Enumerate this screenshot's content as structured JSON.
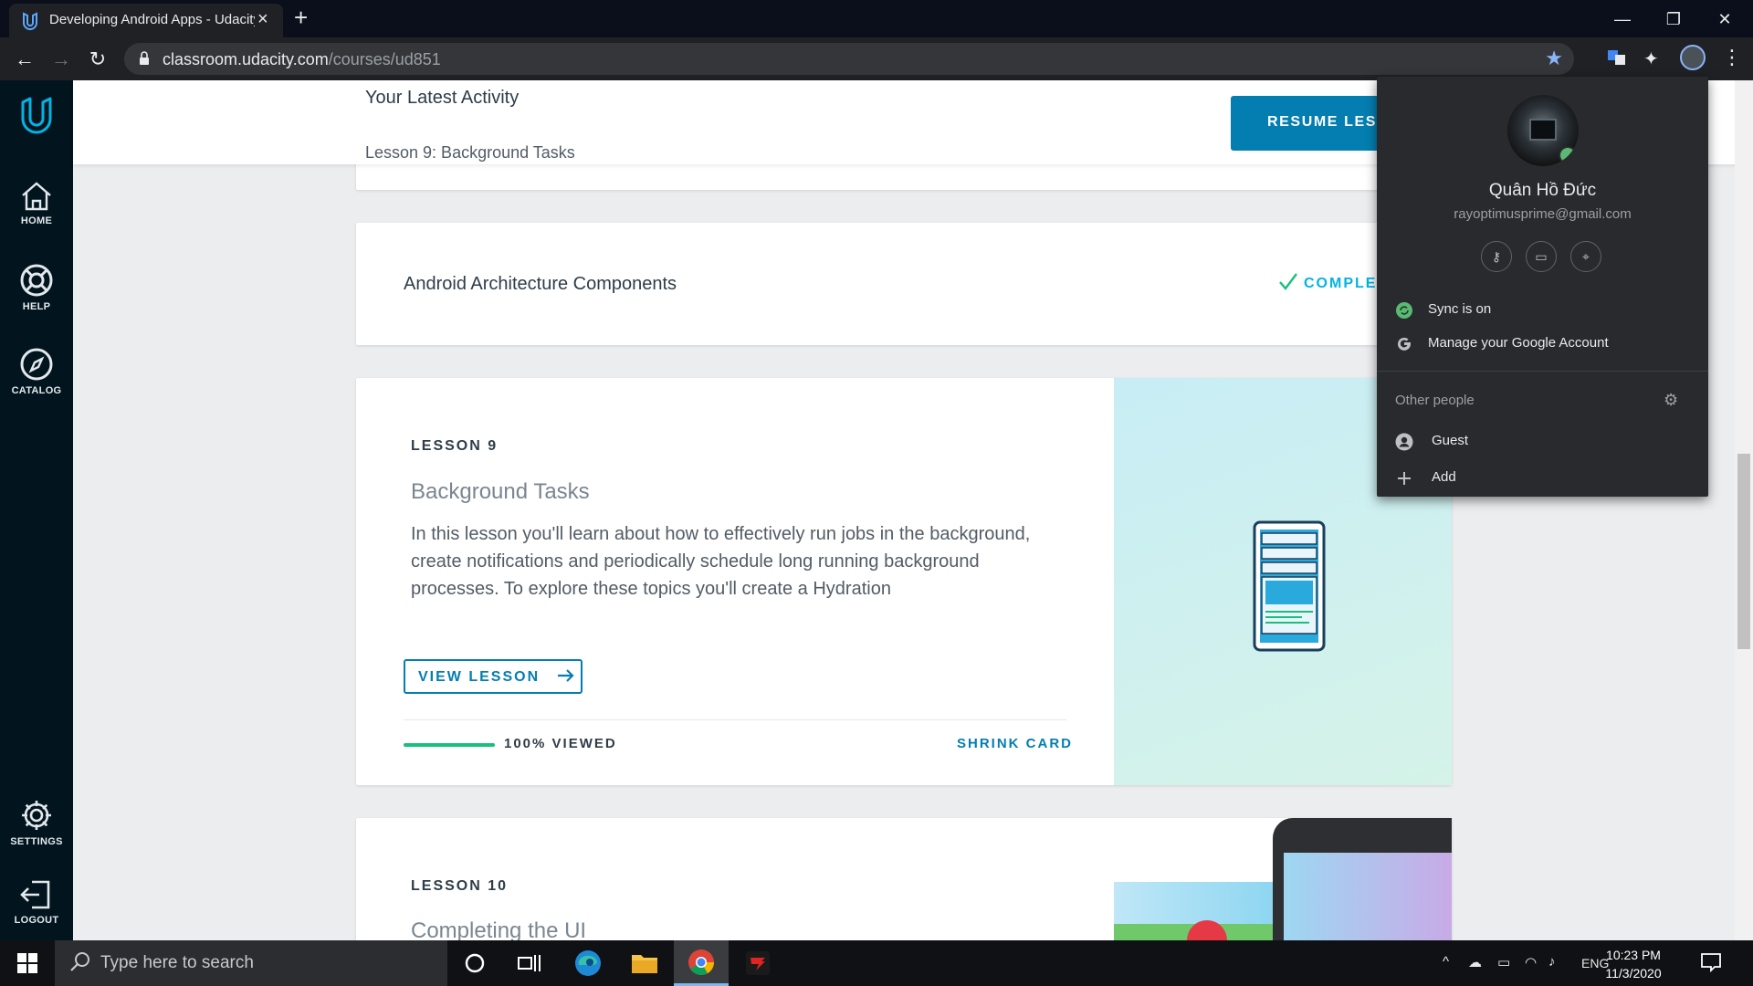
{
  "browser": {
    "tab_title": "Developing Android Apps - Udacity",
    "new_tab_symbol": "+",
    "url_host": "classroom.udacity.com",
    "url_path": "/courses/ud851",
    "colors": {
      "titlebar": "#0b0f1c",
      "toolbar": "#202124",
      "omnibox": "#35363a",
      "star": "#8ab4f8"
    }
  },
  "sidebar": {
    "items": [
      {
        "label": "HOME",
        "icon": "home-icon"
      },
      {
        "label": "HELP",
        "icon": "lifebuoy-icon"
      },
      {
        "label": "CATALOG",
        "icon": "compass-icon"
      },
      {
        "label": "SETTINGS",
        "icon": "gear-icon"
      },
      {
        "label": "LOGOUT",
        "icon": "logout-icon"
      }
    ],
    "logo_icon": "udacity-logo-icon",
    "colors": {
      "background": "#02151f",
      "logo": "#02b3e4"
    }
  },
  "activity": {
    "title": "Your Latest Activity",
    "subtitle": "Lesson 9: Background Tasks",
    "resume_label": "RESUME LESSON"
  },
  "lessons": {
    "arch": {
      "title": "Android Architecture Components",
      "status": "COMPLETED"
    },
    "lesson9": {
      "number": "LESSON 9",
      "title": "Background Tasks",
      "description": "In this lesson you'll learn about how to effectively run jobs in the background, create notifications and periodically schedule long running background processes. To explore these topics you'll create a Hydration",
      "view_label": "VIEW LESSON",
      "progress_label": "100% VIEWED",
      "progress": 1.0,
      "shrink_label": "SHRINK CARD"
    },
    "lesson10": {
      "number": "LESSON 10",
      "title": "Completing the UI"
    },
    "colors": {
      "accent": "#047eb0",
      "progress": "#18bf7d",
      "complete": "#02b3e4"
    }
  },
  "profile": {
    "name": "Quân Hồ Đức",
    "email": "rayoptimusprime@gmail.com",
    "quick_icons": [
      "key-icon",
      "card-icon",
      "location-pin-icon"
    ],
    "sync_label": "Sync is on",
    "manage_label": "Manage your Google Account",
    "other_people_label": "Other people",
    "guest_label": "Guest",
    "add_label": "Add"
  },
  "taskbar": {
    "search_placeholder": "Type here to search",
    "language": "ENG",
    "time": "10:23 PM",
    "date": "11/3/2020",
    "pinned": [
      "cortana-icon",
      "task-view-icon",
      "edge-icon",
      "file-explorer-icon",
      "chrome-icon",
      "game-app-icon"
    ]
  }
}
